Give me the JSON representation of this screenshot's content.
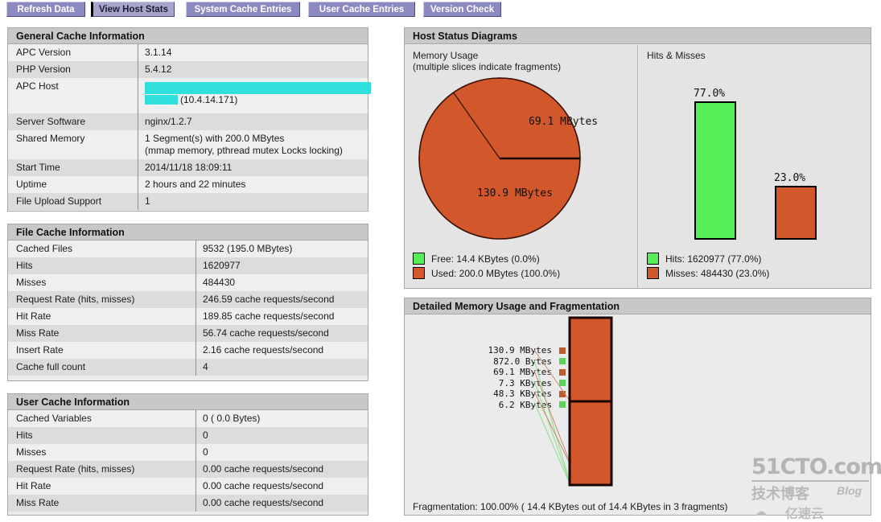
{
  "nav": {
    "buttons": [
      {
        "label": "Refresh Data",
        "active": false
      },
      {
        "label": "View Host Stats",
        "active": true
      },
      {
        "label": "System Cache Entries",
        "active": false
      },
      {
        "label": "User Cache Entries",
        "active": false
      },
      {
        "label": "Version Check",
        "active": false
      }
    ]
  },
  "general_cache": {
    "title": "General Cache Information",
    "rows": [
      {
        "key": "APC Version",
        "value": "3.1.14"
      },
      {
        "key": "PHP Version",
        "value": "5.4.12"
      },
      {
        "key": "APC Host",
        "value": "(10.4.14.171)",
        "redacted": true
      },
      {
        "key": "Server Software",
        "value": "nginx/1.2.7"
      },
      {
        "key": "Shared Memory",
        "value": "1 Segment(s) with 200.0 MBytes\n(mmap memory, pthread mutex Locks locking)"
      },
      {
        "key": "Start Time",
        "value": "2014/11/18 18:09:11"
      },
      {
        "key": "Uptime",
        "value": "2 hours and 22 minutes"
      },
      {
        "key": "File Upload Support",
        "value": "1"
      }
    ]
  },
  "file_cache": {
    "title": "File Cache Information",
    "rows": [
      {
        "key": "Cached Files",
        "value": "9532 (195.0 MBytes)"
      },
      {
        "key": "Hits",
        "value": "1620977"
      },
      {
        "key": "Misses",
        "value": "484430"
      },
      {
        "key": "Request Rate (hits, misses)",
        "value": "246.59 cache requests/second"
      },
      {
        "key": "Hit Rate",
        "value": "189.85 cache requests/second"
      },
      {
        "key": "Miss Rate",
        "value": "56.74 cache requests/second"
      },
      {
        "key": "Insert Rate",
        "value": "2.16 cache requests/second"
      },
      {
        "key": "Cache full count",
        "value": "4"
      }
    ]
  },
  "user_cache": {
    "title": "User Cache Information",
    "rows": [
      {
        "key": "Cached Variables",
        "value": "0 ( 0.0 Bytes)"
      },
      {
        "key": "Hits",
        "value": "0"
      },
      {
        "key": "Misses",
        "value": "0"
      },
      {
        "key": "Request Rate (hits, misses)",
        "value": "0.00 cache requests/second"
      },
      {
        "key": "Hit Rate",
        "value": "0.00 cache requests/second"
      },
      {
        "key": "Miss Rate",
        "value": "0.00 cache requests/second"
      }
    ]
  },
  "host_status": {
    "title": "Host Status Diagrams",
    "memory": {
      "title_line1": "Memory Usage",
      "title_line2": "(multiple slices indicate fragments)",
      "legend": [
        {
          "label": "Free: 14.4 KBytes (0.0%)",
          "color": "#55ee55"
        },
        {
          "label": "Used: 200.0 MBytes (100.0%)",
          "color": "#d2572a"
        }
      ]
    },
    "hits": {
      "title": "Hits & Misses",
      "legend": [
        {
          "label": "Hits: 1620977 (77.0%)",
          "color": "#55ee55"
        },
        {
          "label": "Misses: 484430 (23.0%)",
          "color": "#d2572a"
        }
      ]
    }
  },
  "fragmentation_panel": {
    "title": "Detailed Memory Usage and Fragmentation",
    "note": "Fragmentation: 100.00% ( 14.4 KBytes out of 14.4 KBytes in 3 fragments)",
    "labels": [
      {
        "text": "130.9 MBytes",
        "color": "#c05a30"
      },
      {
        "text": "872.0 Bytes",
        "color": "#5ad45a"
      },
      {
        "text": "69.1 MBytes",
        "color": "#c05a30"
      },
      {
        "text": "7.3 KBytes",
        "color": "#5ad45a"
      },
      {
        "text": "48.3 KBytes",
        "color": "#c05a30"
      },
      {
        "text": "6.2 KBytes",
        "color": "#5ad45a"
      }
    ]
  },
  "watermark": {
    "line1": "51CTO.com",
    "line2": "技术博客",
    "line3": "Blog",
    "line4": "亿速云"
  },
  "colors": {
    "used": "#d2572a",
    "free": "#55ee55",
    "nav": "#8a8ac0",
    "nav_active": "#a6a6cc",
    "panel_head": "#c8c8c8"
  },
  "chart_data": [
    {
      "type": "pie",
      "title": "Memory Usage",
      "subtitle": "(multiple slices indicate fragments)",
      "categories": [
        "69.1 MBytes",
        "130.9 MBytes"
      ],
      "values": [
        69.1,
        130.9
      ],
      "unit": "MBytes",
      "slice_labels": [
        "69.1 MBytes",
        "130.9 MBytes"
      ],
      "colors": [
        "#d2572a",
        "#d2572a"
      ],
      "legend_position": "bottom",
      "legend": [
        "Free: 14.4 KBytes (0.0%)",
        "Used: 200.0 MBytes (100.0%)"
      ]
    },
    {
      "type": "bar",
      "title": "Hits & Misses",
      "categories": [
        "Hits",
        "Misses"
      ],
      "values": [
        77.0,
        23.0
      ],
      "data_labels": [
        "77.0%",
        "23.0%"
      ],
      "colors": [
        "#55ee55",
        "#d2572a"
      ],
      "ylim": [
        0,
        100
      ],
      "ylabel": "",
      "xlabel": "",
      "grid": false,
      "legend_position": "bottom",
      "legend": [
        "Hits: 1620977 (77.0%)",
        "Misses: 484430 (23.0%)"
      ]
    },
    {
      "type": "bar",
      "title": "Detailed Memory Usage and Fragmentation",
      "orientation": "vertical-stacked",
      "categories": [
        "130.9 MBytes",
        "872.0 Bytes",
        "69.1 MBytes",
        "7.3 KBytes",
        "48.3 KBytes",
        "6.2 KBytes"
      ],
      "values": [
        130.9,
        0.000872,
        69.1,
        0.0073,
        0.0483,
        0.0062
      ],
      "unit": "MBytes",
      "colors": [
        "#c05a30",
        "#5ad45a",
        "#c05a30",
        "#5ad45a",
        "#c05a30",
        "#5ad45a"
      ],
      "annotation": "Fragmentation: 100.00% ( 14.4 KBytes out of 14.4 KBytes in 3 fragments)"
    }
  ]
}
